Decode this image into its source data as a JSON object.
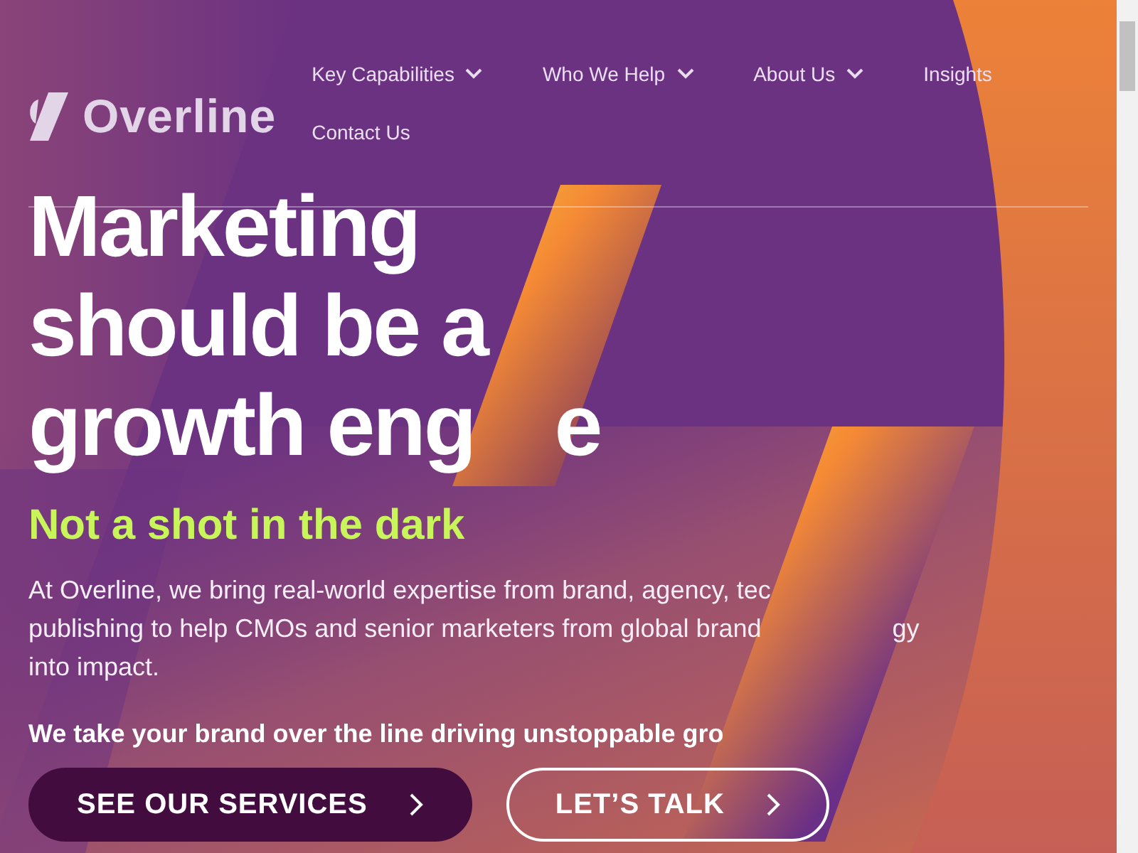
{
  "header": {
    "logo": "Overline",
    "nav": [
      {
        "label": "Key Capabilities",
        "dropdown": true
      },
      {
        "label": "Who We Help",
        "dropdown": true
      },
      {
        "label": "About Us",
        "dropdown": true
      },
      {
        "label": "Insights",
        "dropdown": false
      },
      {
        "label": "Contact Us",
        "dropdown": false
      }
    ]
  },
  "hero": {
    "headline": [
      [
        "Marketing"
      ],
      [
        "should be a"
      ],
      [
        "growth eng",
        "e"
      ]
    ],
    "tagline": "Not a shot in the dark",
    "intro": [
      [
        "At Overline, we bring real-world expertise from brand, agency, tec"
      ],
      [
        "publishing to help CMOs and senior marketers from global brand",
        "gy"
      ],
      [
        "into impact."
      ]
    ],
    "statement": "We take your brand over the line driving unstoppable gro",
    "buttons": [
      {
        "label": "SEE OUR SERVICES",
        "kind": "filled"
      },
      {
        "label": "LET’S TALK",
        "kind": "outline"
      }
    ]
  }
}
